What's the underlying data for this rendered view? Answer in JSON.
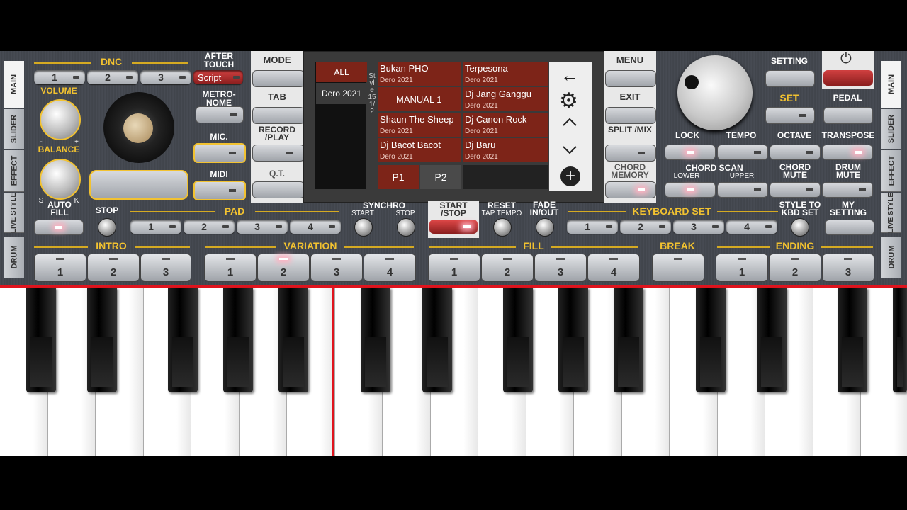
{
  "side_tabs": {
    "main": "MAIN",
    "slider": "SLIDER",
    "effect": "EFFECT",
    "live_style": "LIVE STYLE",
    "drum": "DRUM"
  },
  "left": {
    "dnc": "DNC",
    "dnc_buttons": [
      "1",
      "2",
      "3"
    ],
    "script": "Script",
    "after_touch": "AFTER TOUCH",
    "volume": "VOLUME",
    "balance": "BALANCE",
    "metronome": "METRO- NOME",
    "mic": "MIC.",
    "midi": "MIDI",
    "minus": "-",
    "plus": "+",
    "s": "S",
    "k": "K"
  },
  "center_buttons": {
    "mode": "MODE",
    "tab": "TAB",
    "record_play": "RECORD /PLAY",
    "qt": "Q.T."
  },
  "screen": {
    "all": "ALL",
    "folder": "Dero 2021",
    "side_text": "Style 15 1/2",
    "styles": [
      {
        "name": "Bukan PHO",
        "sub": "Dero 2021"
      },
      {
        "name": "Terpesona",
        "sub": "Dero 2021"
      },
      {
        "name": "MANUAL 1",
        "sub": ""
      },
      {
        "name": "Dj Jang Ganggu",
        "sub": "Dero 2021"
      },
      {
        "name": "Shaun The Sheep",
        "sub": "Dero 2021"
      },
      {
        "name": "Dj Canon Rock",
        "sub": "Dero 2021"
      },
      {
        "name": "Dj Bacot Bacot",
        "sub": "Dero 2021"
      },
      {
        "name": "Dj Baru",
        "sub": "Dero 2021"
      }
    ],
    "pages": [
      "P1",
      "P2"
    ]
  },
  "right_buttons": {
    "menu": "MENU",
    "exit": "EXIT",
    "split_mix": "SPLIT /MIX",
    "chord_memory": "CHORD MEMORY"
  },
  "right": {
    "setting": "SETTING",
    "set": "SET",
    "pedal": "PEDAL",
    "lock": "LOCK",
    "tempo": "TEMPO",
    "octave": "OCTAVE",
    "transpose": "TRANSPOSE",
    "chord_scan": "CHORD SCAN",
    "lower": "LOWER",
    "upper": "UPPER",
    "chord_mute": "CHORD MUTE",
    "drum_mute": "DRUM MUTE"
  },
  "row3": {
    "auto_fill": "AUTO FILL",
    "stop": "STOP",
    "pad": "PAD",
    "pad_buttons": [
      "1",
      "2",
      "3",
      "4"
    ],
    "synchro": "SYNCHRO",
    "start": "START",
    "stop2": "STOP",
    "start_stop": "START /STOP",
    "reset": "RESET",
    "tap_tempo": "TAP TEMPO",
    "fade": "FADE IN/OUT",
    "keyboard_set": "KEYBOARD SET",
    "kbd_buttons": [
      "1",
      "2",
      "3",
      "4"
    ],
    "style_to_kbd": "STYLE TO KBD SET",
    "my_setting": "MY SETTING"
  },
  "row4": {
    "intro": "INTRO",
    "intro_buttons": [
      "1",
      "2",
      "3"
    ],
    "variation": "VARIATION",
    "variation_buttons": [
      "1",
      "2",
      "3",
      "4"
    ],
    "fill": "FILL",
    "fill_buttons": [
      "1",
      "2",
      "3",
      "4"
    ],
    "break": "BREAK",
    "ending": "ENDING",
    "ending_buttons": [
      "1",
      "2",
      "3"
    ]
  },
  "colors": {
    "accent": "#f2c230",
    "style_cell": "#7d2418",
    "keyboard_divider": "#e0141e"
  }
}
